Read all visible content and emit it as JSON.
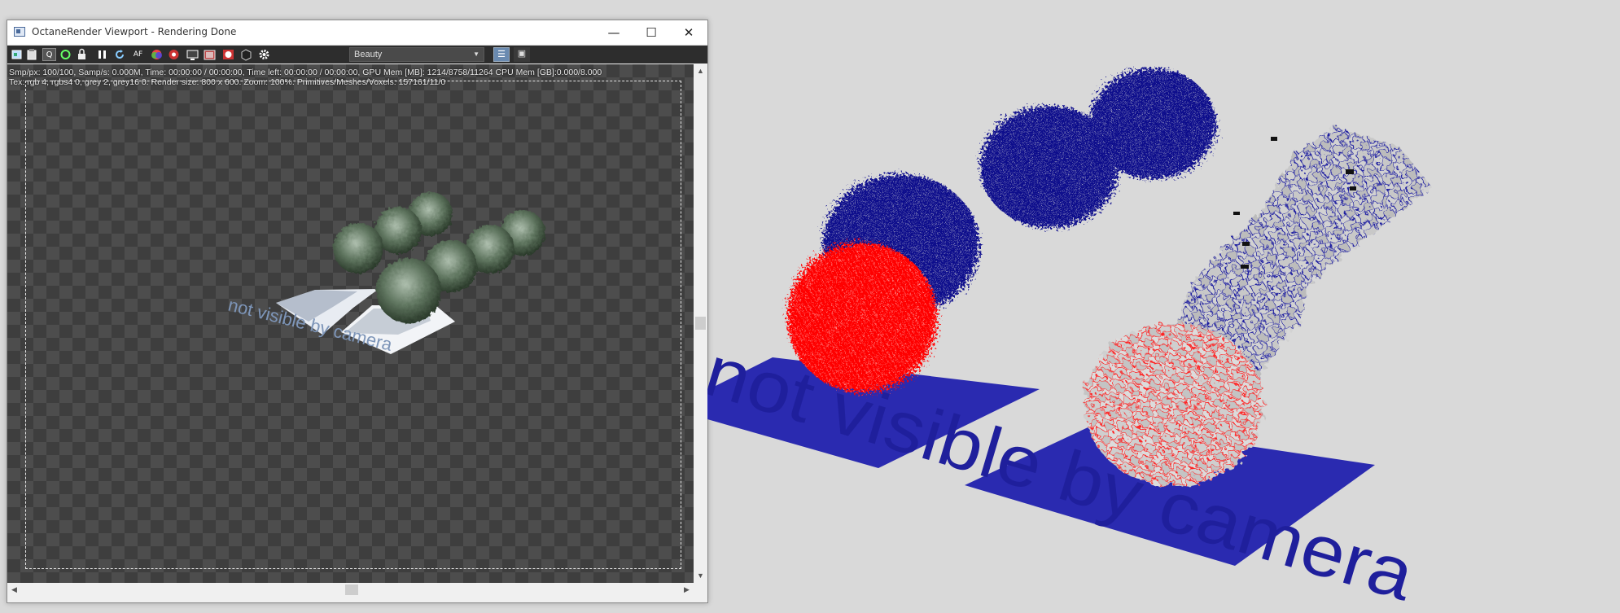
{
  "window": {
    "title": "OctaneRender Viewport - Rendering Done",
    "minimize": "—",
    "maximize": "☐",
    "close": "✕"
  },
  "toolbar": {
    "icons": [
      "camera-icon",
      "clipboard-icon",
      "q-icon",
      "refresh-icon",
      "lock-icon",
      "pause-icon",
      "restart-icon",
      "af-icon",
      "color-wheel-icon",
      "flower-icon",
      "monitor-icon",
      "film-icon",
      "sphere-icon",
      "box-icon",
      "settings-icon"
    ],
    "af_label": "AF",
    "q_label": "Q",
    "render_pass": "Beauty"
  },
  "stats": {
    "line1": "Smp/px: 100/100,  Samp/s: 0.000M,  Time: 00:00:00 / 00:00:00,  Time left: 00:00:00 / 00:00:00,  GPU Mem [MB]: 1214/8758/11264  CPU Mem [GB]:0.000/8.000",
    "line2": "Tex: rgb 4, rgbs4 0, grey 2, grey16 0.  Render size: 800 x 600.  Zoom: 100%.  Primitives/Meshes/Voxels: 157161/11/0"
  },
  "render": {
    "overlay_text": "not visible by camera"
  },
  "scene": {
    "overlay_text": "not visible by camera",
    "colors": {
      "highlight": "#ff0000",
      "wire": "#0a0a8c",
      "plane": "#2a2ab0"
    }
  }
}
